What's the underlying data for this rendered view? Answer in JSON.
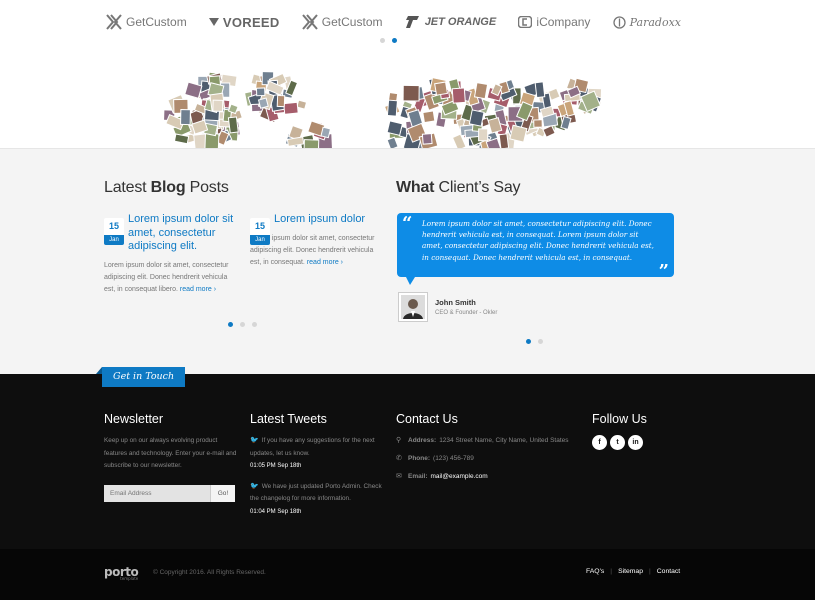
{
  "clients": {
    "logos": [
      {
        "name": "GetCustom",
        "icon": "x-mark-icon"
      },
      {
        "name": "VOREED",
        "icon": "v-mark-icon"
      },
      {
        "name": "GetCustom",
        "icon": "x-mark-icon"
      },
      {
        "name": "JET ORANGE",
        "icon": "jet-mark-icon"
      },
      {
        "name": "iCompany",
        "icon": "c-mark-icon"
      },
      {
        "name": "Paradoxx",
        "icon": "circle-mark-icon"
      }
    ],
    "map_label": "world map photo collage"
  },
  "blog": {
    "title_pre": "Latest ",
    "title_bold": "Blog",
    "title_post": " Posts",
    "posts": [
      {
        "day": "15",
        "month": "Jan",
        "title": "Lorem ipsum dolor sit amet, consectetur adipiscing elit.",
        "excerpt": "Lorem ipsum dolor sit amet, consectetur adipiscing elit. Donec hendrerit vehicula est, in consequat libero.",
        "more": "read more ›"
      },
      {
        "day": "15",
        "month": "Jan",
        "title": "Lorem ipsum dolor",
        "excerpt": "Lorem ipsum dolor sit amet, consectetur adipiscing elit. Donec hendrerit vehicula est, in consequat.",
        "more": "read more ›"
      }
    ]
  },
  "testimonial": {
    "title_bold": "What",
    "title_post": " Client’s Say",
    "quote": "Lorem ipsum dolor sit amet, consectetur adipiscing elit. Donec hendrerit vehicula est, in consequat. Lorem ipsum dolor sit amet, consectetur adipiscing elit. Donec hendrerit vehicula est, in consequat. Donec hendrerit vehicula est, in consequat.",
    "open_mark": "“",
    "close_mark": "”",
    "author_name": "John Smith",
    "author_role": "CEO & Founder - Okler"
  },
  "footer": {
    "ribbon": "Get in Touch",
    "newsletter": {
      "title": "Newsletter",
      "text": "Keep up on our always evolving product features and technology. Enter your e-mail and subscribe to our newsletter.",
      "placeholder": "Email Address",
      "button": "Go!"
    },
    "tweets": {
      "title": "Latest Tweets",
      "items": [
        {
          "text": "If you have any suggestions for the next updates, let us know.",
          "time": "01:05 PM Sep 18th"
        },
        {
          "text": "We have just updated Porto Admin. Check the changelog for more information.",
          "time": "01:04 PM Sep 18th"
        }
      ]
    },
    "contact": {
      "title": "Contact Us",
      "address_label": "Address:",
      "address": "1234 Street Name, City Name, United States",
      "phone_label": "Phone:",
      "phone": "(123) 456-789",
      "email_label": "Email:",
      "email": "mail@example.com"
    },
    "follow": {
      "title": "Follow Us",
      "networks": [
        "f",
        "t",
        "in"
      ]
    }
  },
  "copyright": {
    "logo": "porto",
    "logo_sub": "template",
    "text": "© Copyright 2016. All Rights Reserved.",
    "links": [
      "FAQ's",
      "Sitemap",
      "Contact"
    ]
  },
  "colors": {
    "accent": "#0e7ac4",
    "quote_bg": "#0e8ce6",
    "footer_bg": "#0e0e0e"
  }
}
